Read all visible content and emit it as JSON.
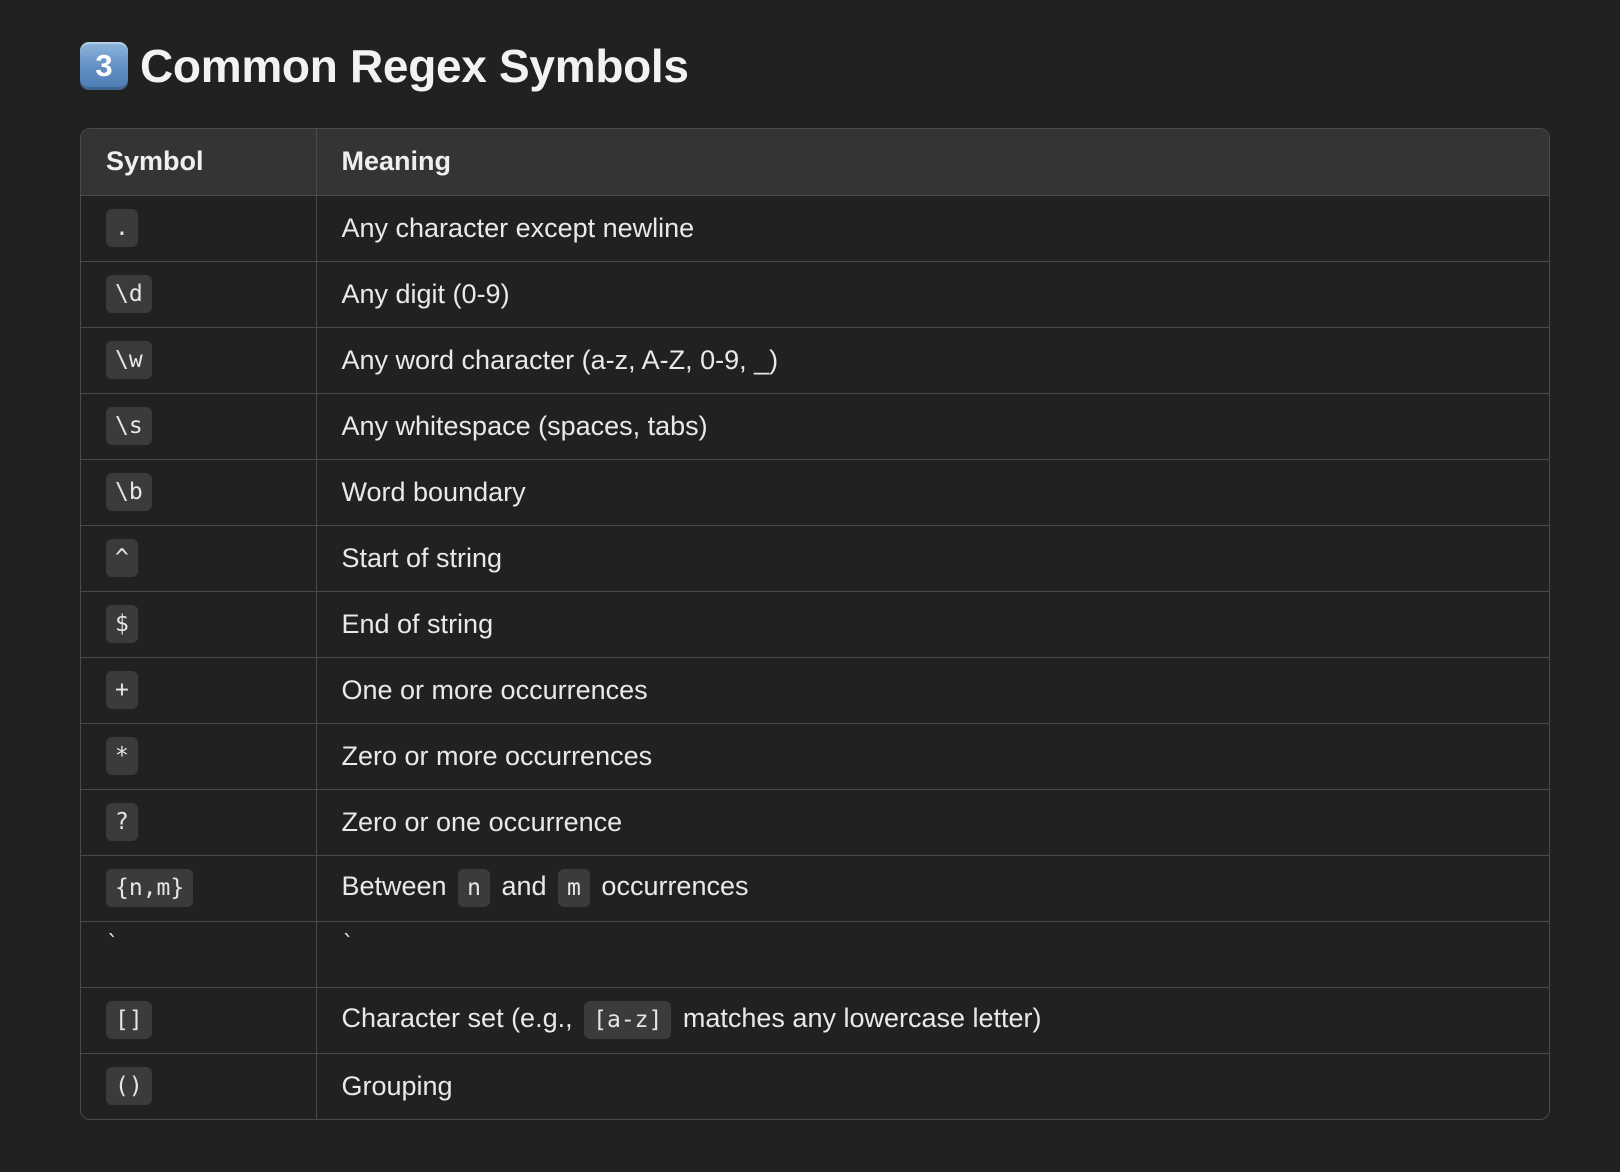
{
  "heading": {
    "badge": "3",
    "title": "Common Regex Symbols"
  },
  "table": {
    "headers": [
      "Symbol",
      "Meaning"
    ],
    "rows": [
      {
        "symbol": ".",
        "meaning": "Any character except newline"
      },
      {
        "symbol": "\\d",
        "meaning": "Any digit (0-9)"
      },
      {
        "symbol": "\\w",
        "meaning": "Any word character (a-z, A-Z, 0-9, _)"
      },
      {
        "symbol": "\\s",
        "meaning": "Any whitespace (spaces, tabs)"
      },
      {
        "symbol": "\\b",
        "meaning": "Word boundary"
      },
      {
        "symbol": "^",
        "meaning": "Start of string"
      },
      {
        "symbol": "$",
        "meaning": "End of string"
      },
      {
        "symbol": "+",
        "meaning": "One or more occurrences"
      },
      {
        "symbol": "*",
        "meaning": "Zero or more occurrences"
      },
      {
        "symbol": "?",
        "meaning": "Zero or one occurrence"
      },
      {
        "symbol": "{n,m}",
        "meaning_parts": [
          "Between",
          "n",
          "and",
          "m",
          "occurrences"
        ]
      },
      {
        "symbol": "`",
        "meaning": "`"
      },
      {
        "symbol": "[]",
        "meaning_parts": [
          "Character set (e.g.,",
          "[a-z]",
          "matches any lowercase letter)"
        ]
      },
      {
        "symbol": "()",
        "meaning": "Grouping"
      }
    ]
  }
}
